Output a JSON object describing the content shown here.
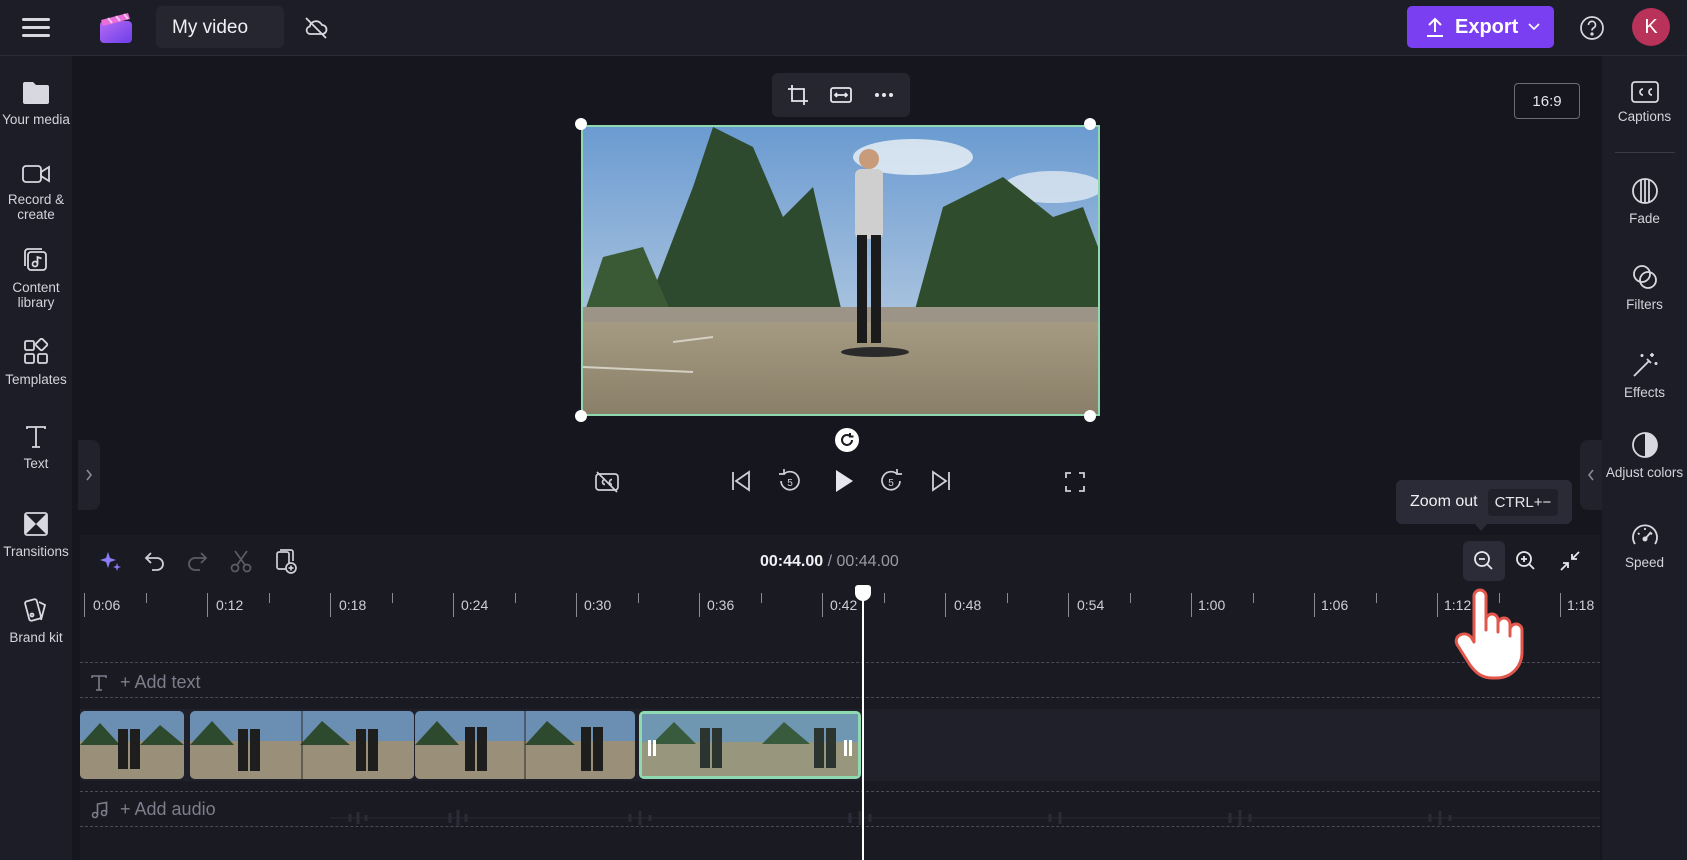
{
  "header": {
    "title": "My video",
    "export_label": "Export",
    "avatar_initial": "K"
  },
  "left_sidebar": {
    "items": [
      {
        "label": "Your media",
        "icon": "folder-icon"
      },
      {
        "label": "Record & create",
        "icon": "video-camera-icon"
      },
      {
        "label": "Content library",
        "icon": "content-library-icon"
      },
      {
        "label": "Templates",
        "icon": "templates-icon"
      },
      {
        "label": "Text",
        "icon": "text-icon"
      },
      {
        "label": "Transitions",
        "icon": "transitions-icon"
      },
      {
        "label": "Brand kit",
        "icon": "brand-kit-icon"
      }
    ]
  },
  "right_sidebar": {
    "items": [
      {
        "label": "Captions",
        "icon": "captions-icon"
      },
      {
        "label": "Fade",
        "icon": "fade-icon"
      },
      {
        "label": "Filters",
        "icon": "filters-icon"
      },
      {
        "label": "Effects",
        "icon": "effects-wand-icon"
      },
      {
        "label": "Adjust colors",
        "icon": "adjust-colors-icon"
      },
      {
        "label": "Speed",
        "icon": "speed-gauge-icon"
      }
    ]
  },
  "preview": {
    "aspect_ratio": "16:9"
  },
  "timeline": {
    "current_time": "00:44.00",
    "separator": "/",
    "total_time": "00:44.00",
    "ruler_labels": [
      "0:06",
      "0:12",
      "0:18",
      "0:24",
      "0:30",
      "0:36",
      "0:42",
      "0:48",
      "0:54",
      "1:00",
      "1:06",
      "1:12",
      "1:18"
    ],
    "add_text_label": "+ Add text",
    "add_audio_label": "+ Add audio"
  },
  "tooltip": {
    "label": "Zoom out",
    "shortcut": "CTRL+−"
  },
  "colors": {
    "accent": "#7b3ff2",
    "selection": "#8fd9b0",
    "avatar": "#b8325a"
  }
}
